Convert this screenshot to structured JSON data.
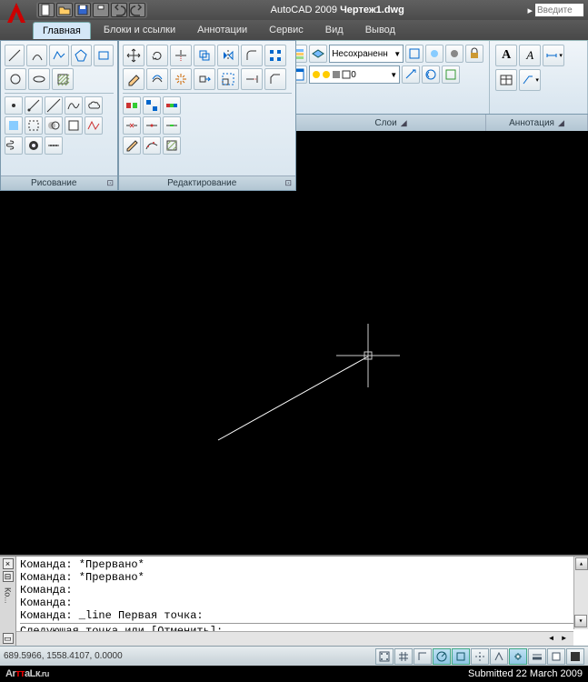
{
  "app": {
    "title_prefix": "AutoCAD 2009",
    "document": "Чертеж1.dwg",
    "search_placeholder": "Введите"
  },
  "qat": [
    "new",
    "open",
    "save",
    "print",
    "undo",
    "redo"
  ],
  "tabs": [
    {
      "label": "Главная",
      "active": true
    },
    {
      "label": "Блоки и ссылки",
      "active": false
    },
    {
      "label": "Аннотации",
      "active": false
    },
    {
      "label": "Сервис",
      "active": false
    },
    {
      "label": "Вид",
      "active": false
    },
    {
      "label": "Вывод",
      "active": false
    }
  ],
  "ribbon_panels": {
    "layers": {
      "label": "Слои",
      "current_layer": "Несохраненн",
      "layer_state": "0"
    },
    "annotation": {
      "label": "Аннотация"
    }
  },
  "float_panels": {
    "draw": {
      "label": "Рисование"
    },
    "modify": {
      "label": "Редактирование"
    }
  },
  "command_window": {
    "sidebar_label": "Ко...",
    "lines": [
      "Команда: *Прервано*",
      "Команда: *Прервано*",
      "Команда:",
      "Команда:",
      "Команда: _line Первая точка:"
    ],
    "prompt": "Следующая точка или [Отменить]:"
  },
  "statusbar": {
    "coords": "689.5966, 1558.4107, 0.0000"
  },
  "footer": {
    "watermark": "ArттаLк.ru",
    "submitted": "Submitted 22 March 2009"
  }
}
